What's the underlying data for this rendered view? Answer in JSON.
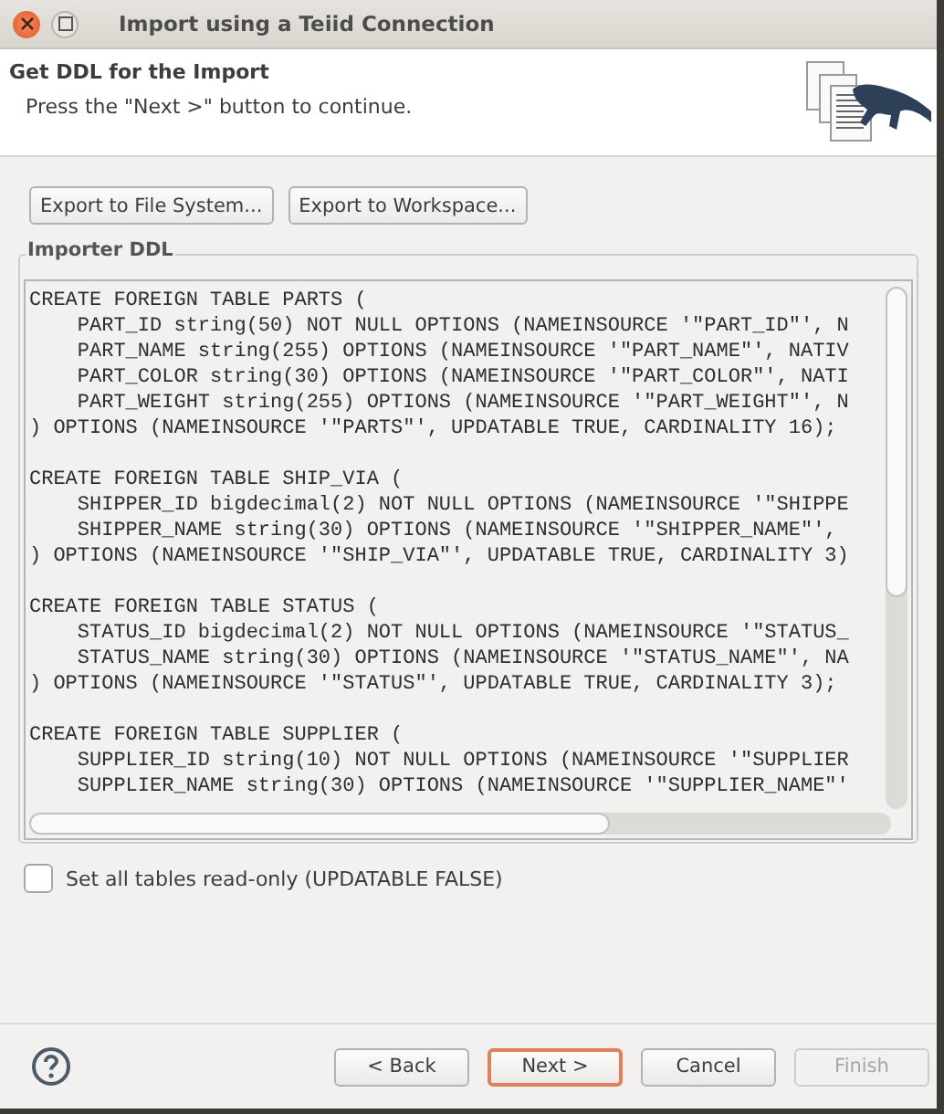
{
  "window": {
    "title": "Import using a Teiid Connection"
  },
  "header": {
    "title": "Get DDL for the Import",
    "message": "Press the \"Next >\" button to continue."
  },
  "export_buttons": [
    "Export to File System...",
    "Export to Workspace..."
  ],
  "ddl": {
    "label": "Importer DDL",
    "blocks": [
      [
        "CREATE FOREIGN TABLE PARTS (",
        "    PART_ID string(50) NOT NULL OPTIONS (NAMEINSOURCE '\"PART_ID\"', N",
        "    PART_NAME string(255) OPTIONS (NAMEINSOURCE '\"PART_NAME\"', NATIV",
        "    PART_COLOR string(30) OPTIONS (NAMEINSOURCE '\"PART_COLOR\"', NATI",
        "    PART_WEIGHT string(255) OPTIONS (NAMEINSOURCE '\"PART_WEIGHT\"', N",
        ") OPTIONS (NAMEINSOURCE '\"PARTS\"', UPDATABLE TRUE, CARDINALITY 16);"
      ],
      [
        "CREATE FOREIGN TABLE SHIP_VIA (",
        "    SHIPPER_ID bigdecimal(2) NOT NULL OPTIONS (NAMEINSOURCE '\"SHIPPE",
        "    SHIPPER_NAME string(30) OPTIONS (NAMEINSOURCE '\"SHIPPER_NAME\"',",
        ") OPTIONS (NAMEINSOURCE '\"SHIP_VIA\"', UPDATABLE TRUE, CARDINALITY 3)"
      ],
      [
        "CREATE FOREIGN TABLE STATUS (",
        "    STATUS_ID bigdecimal(2) NOT NULL OPTIONS (NAMEINSOURCE '\"STATUS_",
        "    STATUS_NAME string(30) OPTIONS (NAMEINSOURCE '\"STATUS_NAME\"', NA",
        ") OPTIONS (NAMEINSOURCE '\"STATUS\"', UPDATABLE TRUE, CARDINALITY 3);"
      ],
      [
        "CREATE FOREIGN TABLE SUPPLIER (",
        "    SUPPLIER_ID string(10) NOT NULL OPTIONS (NAMEINSOURCE '\"SUPPLIER",
        "    SUPPLIER_NAME string(30) OPTIONS (NAMEINSOURCE '\"SUPPLIER_NAME\"'"
      ]
    ]
  },
  "readonly_checkbox": {
    "label": "Set all tables read-only (UPDATABLE FALSE)",
    "checked": false
  },
  "buttons": [
    {
      "label": "< Back",
      "kind": "normal",
      "disabled": false
    },
    {
      "label": "Next >",
      "kind": "default",
      "disabled": false
    },
    {
      "label": "Cancel",
      "kind": "normal",
      "disabled": false
    },
    {
      "label": "Finish",
      "kind": "normal",
      "disabled": true
    }
  ]
}
